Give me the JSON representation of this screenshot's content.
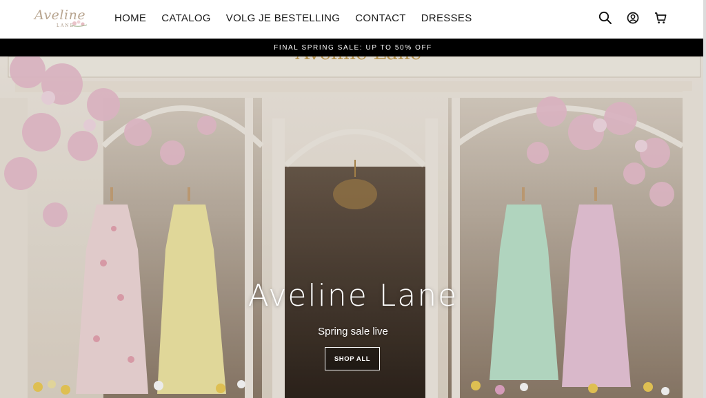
{
  "brand": {
    "logo_script": "Aveline",
    "logo_sub": "LANE"
  },
  "nav": {
    "items": [
      {
        "label": "HOME"
      },
      {
        "label": "CATALOG"
      },
      {
        "label": "VOLG JE BESTELLING"
      },
      {
        "label": "CONTACT"
      },
      {
        "label": "DRESSES"
      }
    ]
  },
  "header_icons": [
    "search-icon",
    "account-icon",
    "cart-icon"
  ],
  "announcement": {
    "text": "FINAL SPRING SALE: UP TO 50% OFF"
  },
  "hero": {
    "title": "Aveline Lane",
    "subtitle": "Spring sale live",
    "button_label": "SHOP ALL"
  },
  "colors": {
    "announcement_bg": "#000000",
    "accent_text": "#ffffff",
    "blossom": "#e7b9c9"
  }
}
